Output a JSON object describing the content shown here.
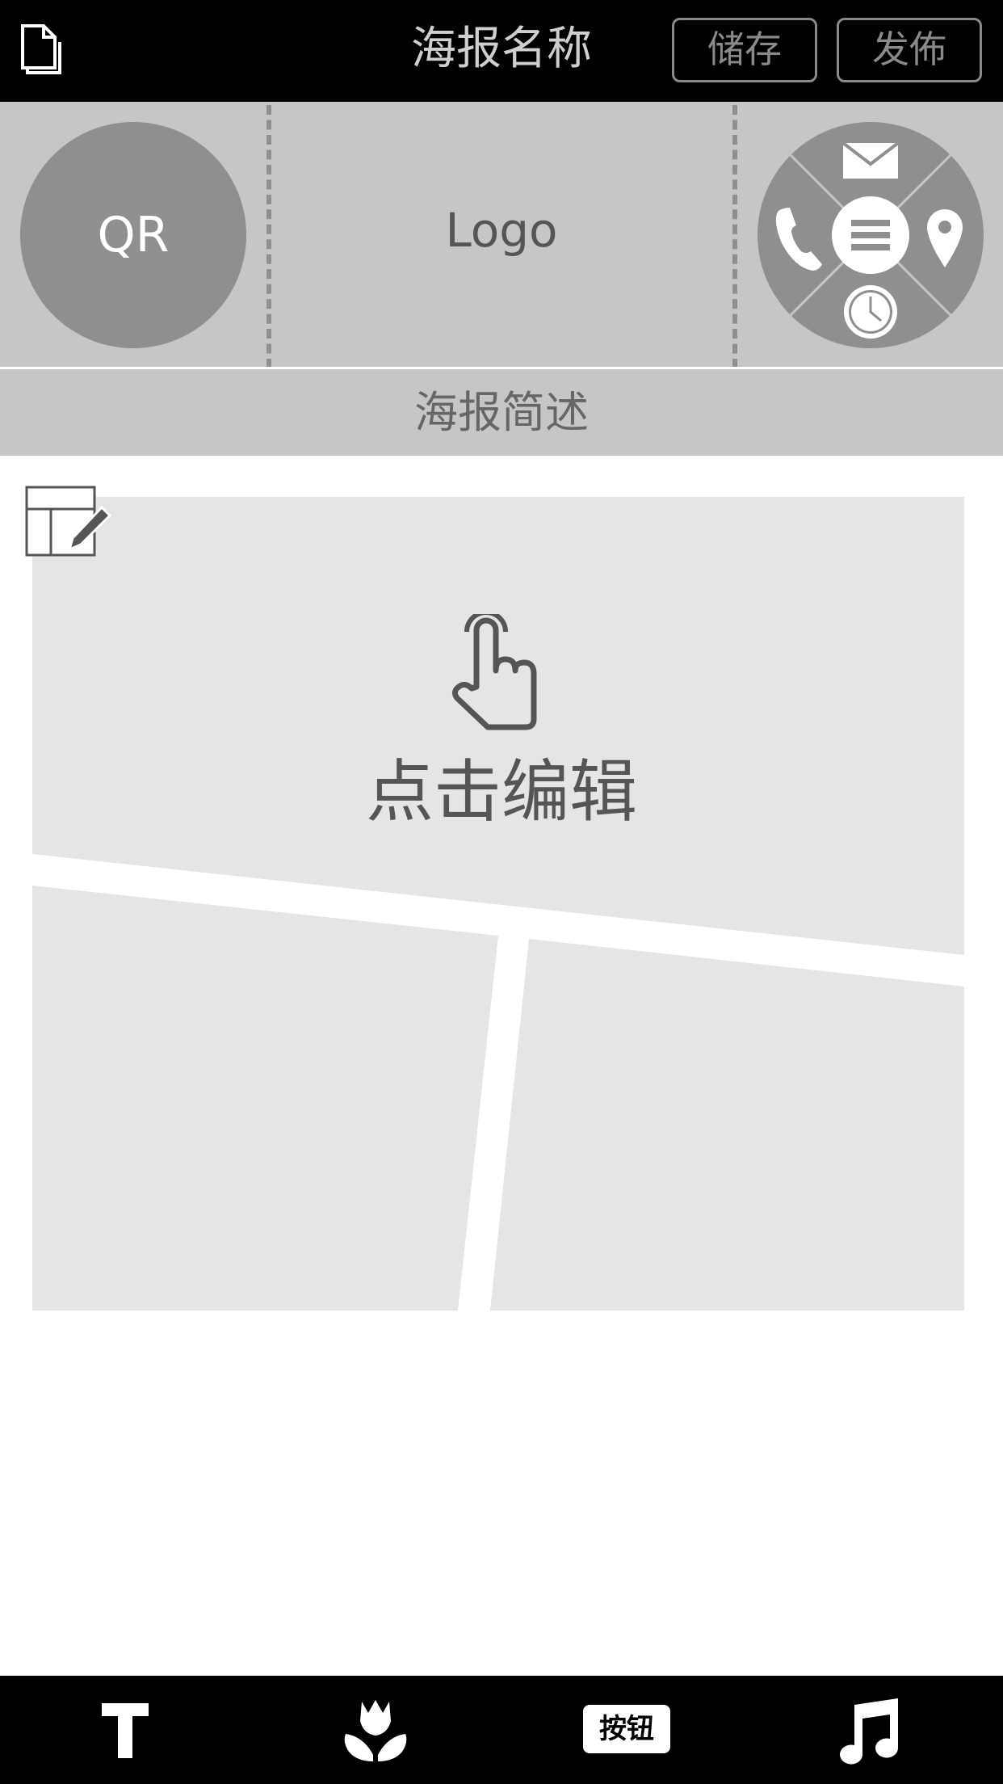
{
  "header": {
    "title": "海报名称",
    "save_label": "储存",
    "publish_label": "发佈"
  },
  "banner": {
    "qr_label": "QR",
    "logo_label": "Logo",
    "contact_icons": [
      "mail-icon",
      "phone-icon",
      "menu-icon",
      "location-icon",
      "clock-icon"
    ]
  },
  "description": "海报简述",
  "canvas": {
    "edit_hint": "点击编辑",
    "layout_icon": "layout-edit-icon",
    "hint_icon": "tap-hand-icon"
  },
  "toolbar": {
    "text_icon": "text-icon",
    "image_icon": "flower-icon",
    "button_label": "按钮",
    "music_icon": "music-icon"
  },
  "colors": {
    "bar_background": "#000000",
    "header_band": "#c6c6c6",
    "circle_gray": "#8f8f8f",
    "content_panel": "#e5e5e5"
  }
}
